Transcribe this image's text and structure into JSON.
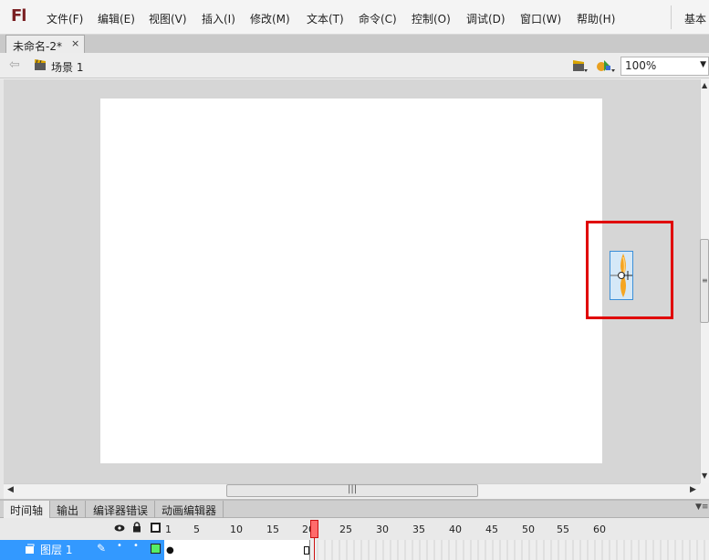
{
  "app": {
    "logo": "Fl"
  },
  "menu": {
    "items": [
      "文件(F)",
      "编辑(E)",
      "视图(V)",
      "插入(I)",
      "修改(M)",
      "文本(T)",
      "命令(C)",
      "控制(O)",
      "调试(D)",
      "窗口(W)",
      "帮助(H)"
    ],
    "workspace": "基本"
  },
  "document": {
    "tab_title": "未命名-2*",
    "close": "×"
  },
  "editbar": {
    "scene_label": "场景 1",
    "zoom": "100%"
  },
  "bottom_panel": {
    "tabs": [
      "时间轴",
      "输出",
      "编译器错误",
      "动画编辑器"
    ],
    "frame_numbers": [
      "1",
      "5",
      "10",
      "15",
      "20",
      "25",
      "30",
      "35",
      "40",
      "45",
      "50",
      "55",
      "60"
    ],
    "current_frame": 21
  },
  "layer": {
    "name": "图层 1",
    "color": "#55ee66"
  },
  "colors": {
    "highlight": "#e00000",
    "selection": "#3399ff",
    "logo": "#7a1f22"
  },
  "icons": [
    "back-arrow-icon",
    "scene-icon",
    "edit-scene-icon",
    "edit-symbol-icon",
    "eye-icon",
    "lock-icon",
    "outline-icon",
    "layer-icon",
    "pencil-icon"
  ]
}
